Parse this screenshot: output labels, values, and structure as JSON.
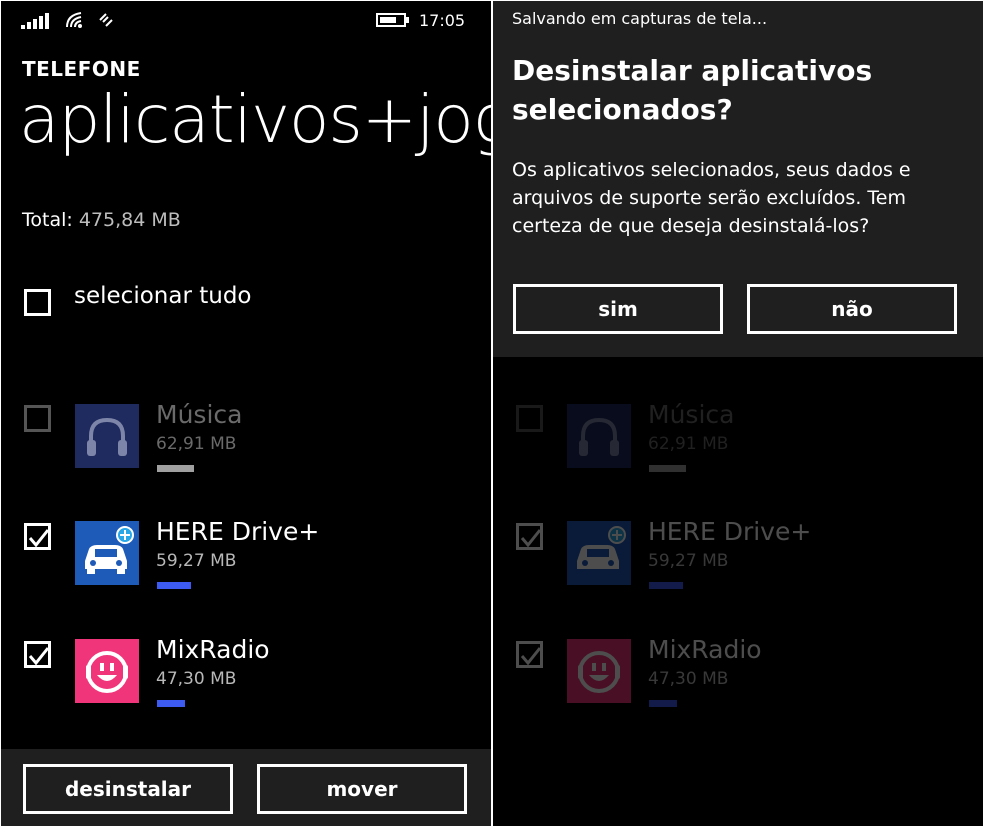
{
  "left": {
    "status_bar": {
      "time": "17:05"
    },
    "header": {
      "app_label": "TELEFONE",
      "title": "aplicativos+jogos"
    },
    "total": {
      "label": "Total:",
      "value": "475,84 MB"
    },
    "select_all": {
      "label": "selecionar tudo"
    },
    "apps": [
      {
        "name": "Música",
        "size": "62,91 MB",
        "checked": false,
        "disabled": true
      },
      {
        "name": "HERE Drive+",
        "size": "59,27 MB",
        "checked": true,
        "disabled": false
      },
      {
        "name": "MixRadio",
        "size": "47,30 MB",
        "checked": true,
        "disabled": false
      }
    ],
    "app_bar": {
      "uninstall_label": "desinstalar",
      "move_label": "mover"
    }
  },
  "right": {
    "toast": "Salvando em capturas de tela...",
    "dialog": {
      "title": "Desinstalar aplicativos selecionados?",
      "message": "Os aplicativos selecionados, seus dados e arquivos de suporte serão excluídos. Tem certeza de que deseja desinstalá-los?",
      "yes_label": "sim",
      "no_label": "não"
    }
  },
  "colors": {
    "background": "#000000",
    "accent_blue": "#3d5af1",
    "music_tile": "#1f2a5e",
    "here_tile": "#1e5ab8",
    "mixradio_tile": "#f0357a",
    "bar_gray": "#a0a0a0"
  }
}
